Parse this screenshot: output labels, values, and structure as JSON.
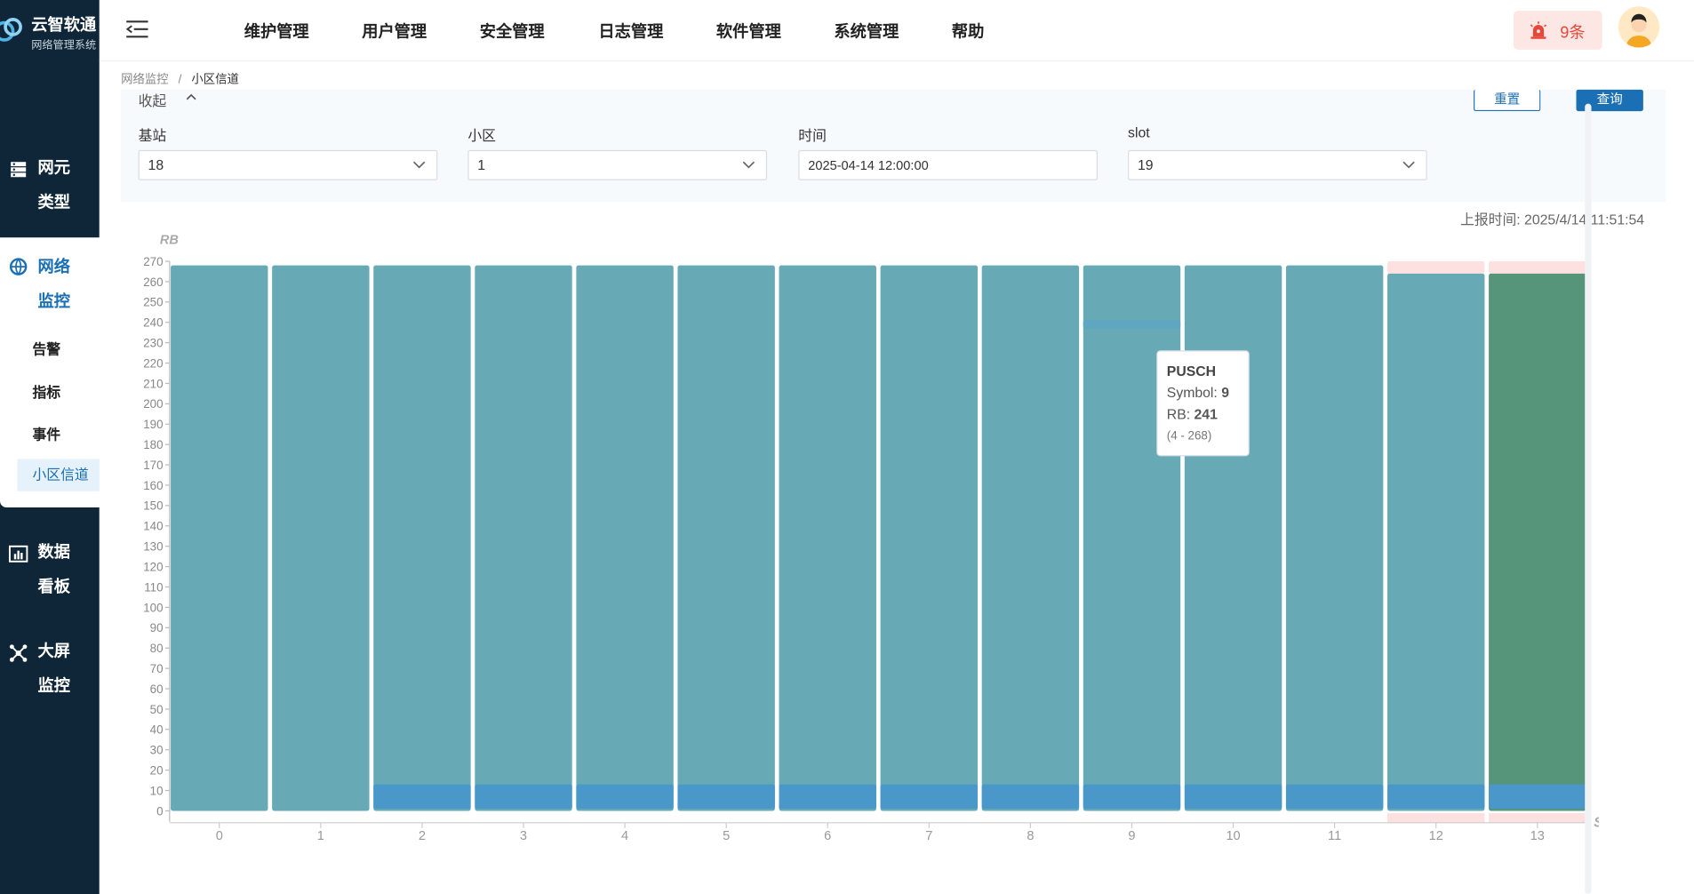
{
  "app": {
    "title": "云智软通",
    "subtitle": "网络管理系统"
  },
  "sidebar": {
    "items": [
      {
        "l1": "网元",
        "l2": "类型",
        "icon": "server-icon"
      },
      {
        "l1": "网络",
        "l2": "监控",
        "icon": "network-monitor-icon",
        "active": true
      },
      {
        "l1": "数据",
        "l2": "看板",
        "icon": "chart-icon"
      },
      {
        "l1": "大屏",
        "l2": "监控",
        "icon": "dashboard-icon"
      }
    ],
    "submenu": [
      "告警",
      "指标",
      "事件",
      "小区信道"
    ]
  },
  "topnav": [
    "维护管理",
    "用户管理",
    "安全管理",
    "日志管理",
    "软件管理",
    "系统管理",
    "帮助"
  ],
  "alarm": {
    "count": "9条"
  },
  "breadcrumb": {
    "parent": "网络监控",
    "sep": "/",
    "current": "小区信道"
  },
  "filter": {
    "collapse_label": "收起",
    "reset_label": "重置",
    "query_label": "查询",
    "fields": [
      {
        "label": "基站",
        "value": "18",
        "type": "select"
      },
      {
        "label": "小区",
        "value": "1",
        "type": "select"
      },
      {
        "label": "时间",
        "value": "2025-04-14 12:00:00",
        "type": "date"
      },
      {
        "label": "slot",
        "value": "19",
        "type": "select"
      }
    ]
  },
  "report_time": "上报时间: 2025/4/14 11:51:54",
  "colors": {
    "pusch": "#67aab6",
    "lowband": "#4a98c9",
    "green": "#569579",
    "pink": "#fde0e0",
    "accent": "#1a6fb5"
  },
  "chart_data": {
    "type": "bar",
    "ylabel": "RB",
    "xlabel": "Symbol",
    "ylim": [
      0,
      270
    ],
    "yticks": [
      0,
      10,
      20,
      30,
      40,
      50,
      60,
      70,
      80,
      90,
      100,
      110,
      120,
      130,
      140,
      150,
      160,
      170,
      180,
      190,
      200,
      210,
      220,
      230,
      240,
      250,
      260,
      270
    ],
    "categories": [
      0,
      1,
      2,
      3,
      4,
      5,
      6,
      7,
      8,
      9,
      10,
      11,
      12,
      13
    ],
    "segments": [
      {
        "symbol": 0,
        "from": 0,
        "to": 268,
        "color": "#67aab6"
      },
      {
        "symbol": 1,
        "from": 0,
        "to": 268,
        "color": "#67aab6"
      },
      {
        "symbol": 2,
        "from": 0,
        "to": 268,
        "color": "#67aab6"
      },
      {
        "symbol": 3,
        "from": 0,
        "to": 268,
        "color": "#67aab6"
      },
      {
        "symbol": 4,
        "from": 0,
        "to": 268,
        "color": "#67aab6"
      },
      {
        "symbol": 5,
        "from": 0,
        "to": 268,
        "color": "#67aab6"
      },
      {
        "symbol": 6,
        "from": 0,
        "to": 268,
        "color": "#67aab6"
      },
      {
        "symbol": 7,
        "from": 0,
        "to": 268,
        "color": "#67aab6"
      },
      {
        "symbol": 8,
        "from": 0,
        "to": 268,
        "color": "#67aab6"
      },
      {
        "symbol": 9,
        "from": 0,
        "to": 268,
        "color": "#67aab6"
      },
      {
        "symbol": 10,
        "from": 0,
        "to": 268,
        "color": "#67aab6"
      },
      {
        "symbol": 11,
        "from": 0,
        "to": 268,
        "color": "#67aab6"
      },
      {
        "symbol": 12,
        "from": 0,
        "to": 264,
        "color": "#67aab6"
      },
      {
        "symbol": 13,
        "from": 0,
        "to": 264,
        "color": "#569579"
      },
      {
        "symbol": 2,
        "from": 1,
        "to": 13,
        "color": "#4a98c9"
      },
      {
        "symbol": 3,
        "from": 1,
        "to": 13,
        "color": "#4a98c9"
      },
      {
        "symbol": 4,
        "from": 1,
        "to": 13,
        "color": "#4a98c9"
      },
      {
        "symbol": 5,
        "from": 1,
        "to": 13,
        "color": "#4a98c9"
      },
      {
        "symbol": 6,
        "from": 1,
        "to": 13,
        "color": "#4a98c9"
      },
      {
        "symbol": 7,
        "from": 1,
        "to": 13,
        "color": "#4a98c9"
      },
      {
        "symbol": 8,
        "from": 1,
        "to": 13,
        "color": "#4a98c9"
      },
      {
        "symbol": 9,
        "from": 1,
        "to": 13,
        "color": "#4a98c9"
      },
      {
        "symbol": 10,
        "from": 1,
        "to": 13,
        "color": "#4a98c9"
      },
      {
        "symbol": 11,
        "from": 1,
        "to": 13,
        "color": "#4a98c9"
      },
      {
        "symbol": 12,
        "from": 1,
        "to": 13,
        "color": "#4a98c9"
      },
      {
        "symbol": 13,
        "from": 1,
        "to": 13,
        "color": "#4a98c9"
      },
      {
        "symbol": 9,
        "from": 237,
        "to": 241,
        "color": "#5ea6c2"
      },
      {
        "symbol": 12,
        "from": 264,
        "to": 270,
        "color": "#fde0e0"
      },
      {
        "symbol": 13,
        "from": 264,
        "to": 270,
        "color": "#fde0e0"
      }
    ],
    "tooltip": {
      "title": "PUSCH",
      "symbol_label": "Symbol:",
      "symbol": "9",
      "rb_label": "RB:",
      "rb": "241",
      "range": "(4 - 268)"
    }
  }
}
